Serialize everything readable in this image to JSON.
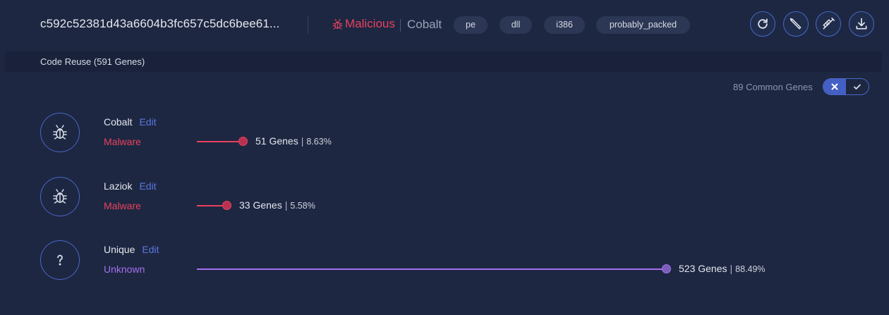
{
  "header": {
    "hash": "c592c52381d43a6604b3fc657c5dc6bee61...",
    "verdict": "Malicious",
    "family": "Cobalt",
    "tags": [
      "pe",
      "dll",
      "i386",
      "probably_packed"
    ],
    "tools": [
      {
        "icon": "refresh-icon"
      },
      {
        "icon": "pencil-icon"
      },
      {
        "icon": "syringe-icon"
      },
      {
        "icon": "download-icon"
      }
    ]
  },
  "section": {
    "title": "Code Reuse (591 Genes)"
  },
  "filter": {
    "label": "89 Common Genes",
    "options": [
      {
        "icon": "close-icon",
        "active": true
      },
      {
        "icon": "check-icon",
        "active": false
      }
    ]
  },
  "genes": [
    {
      "name": "Cobalt",
      "edit": "Edit",
      "type": "Malware",
      "icon": "bug-icon",
      "genes_text": "51 Genes",
      "percent_text": "8.63%",
      "fraction": 0.0863,
      "color": "#e8415f"
    },
    {
      "name": "Laziok",
      "edit": "Edit",
      "type": "Malware",
      "icon": "bug-icon",
      "genes_text": "33 Genes",
      "percent_text": "5.58%",
      "fraction": 0.0558,
      "color": "#e8415f"
    },
    {
      "name": "Unique",
      "edit": "Edit",
      "type": "Unknown",
      "icon": "question-icon",
      "genes_text": "523 Genes",
      "percent_text": "88.49%",
      "fraction": 0.8849,
      "color": "#a570f0"
    }
  ],
  "colors": {
    "malicious": "#e8415f",
    "unknown": "#a570f0",
    "accent": "#4a67c8",
    "background": "#1d2741"
  }
}
